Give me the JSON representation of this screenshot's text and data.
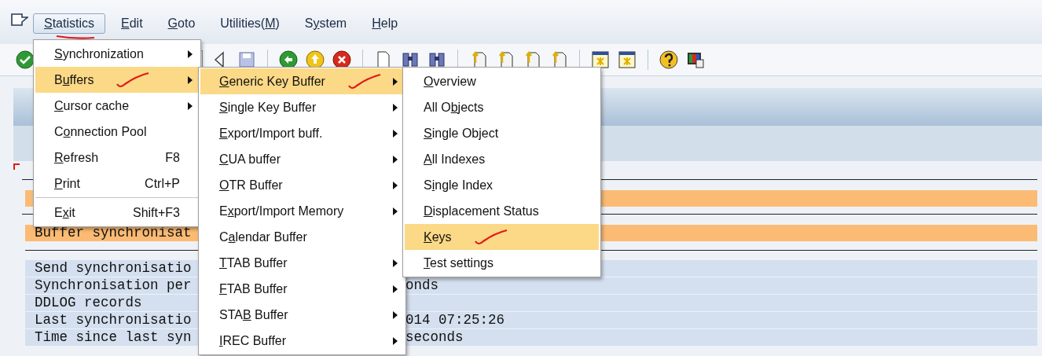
{
  "menu_bar": {
    "items": [
      {
        "key": "S",
        "post": "tatistics",
        "selected": true,
        "annotated": true
      },
      {
        "key": "E",
        "post": "dit",
        "selected": false,
        "annotated": false
      },
      {
        "key": "G",
        "post": "oto",
        "selected": false,
        "annotated": false
      },
      {
        "pre": "Utilities(",
        "key": "M",
        "post": ")",
        "selected": false,
        "annotated": false
      },
      {
        "pre": "S",
        "key": "y",
        "post": "stem",
        "selected": false,
        "annotated": false
      },
      {
        "key": "H",
        "post": "elp",
        "selected": false,
        "annotated": false
      }
    ]
  },
  "page": {
    "status_rows": [
      {},
      {
        "text": "Buffer synchronisat"
      }
    ],
    "info_rows": [
      {
        "label": "Send synchronisatio"
      },
      {
        "label": "Synchronisation per",
        "value": "onds"
      },
      {
        "label": "DDLOG records"
      },
      {
        "label": "Last synchronisatio",
        "value": "014 07:25:26"
      },
      {
        "label": "Time since last syn",
        "value": "seconds"
      }
    ]
  },
  "menus": [
    {
      "items": [
        {
          "key": "S",
          "post": "ynchronization",
          "submenu": true,
          "selected": false,
          "annotated": false
        },
        {
          "pre": "B",
          "key": "u",
          "post": "ffers",
          "submenu": true,
          "selected": true,
          "annotated": true
        },
        {
          "key": "C",
          "post": "ursor cache",
          "submenu": true,
          "selected": false,
          "annotated": false
        },
        {
          "pre": "C",
          "key": "o",
          "post": "nnection Pool",
          "submenu": false,
          "selected": false,
          "annotated": false
        },
        {
          "key": "R",
          "post": "efresh",
          "shortcut": "F8",
          "submenu": false,
          "selected": false,
          "annotated": false
        },
        {
          "key": "P",
          "post": "rint",
          "shortcut": "Ctrl+P",
          "submenu": false,
          "selected": false,
          "annotated": false
        },
        {
          "pre": "E",
          "key": "x",
          "post": "it",
          "shortcut": "Shift+F3",
          "separator_before": true,
          "submenu": false,
          "selected": false,
          "annotated": false
        }
      ]
    },
    {
      "items": [
        {
          "key": "G",
          "post": "eneric Key Buffer",
          "submenu": true,
          "selected": true,
          "annotated": true
        },
        {
          "key": "S",
          "post": "ingle Key Buffer",
          "submenu": true,
          "selected": false,
          "annotated": false
        },
        {
          "key": "E",
          "post": "xport/Import buff.",
          "submenu": true,
          "selected": false,
          "annotated": false
        },
        {
          "key": "C",
          "post": "UA buffer",
          "submenu": true,
          "selected": false,
          "annotated": false
        },
        {
          "key": "O",
          "post": "TR Buffer",
          "submenu": true,
          "selected": false,
          "annotated": false
        },
        {
          "pre": "E",
          "key": "x",
          "post": "port/Import Memory",
          "submenu": true,
          "selected": false,
          "annotated": false
        },
        {
          "pre": "C",
          "key": "a",
          "post": "lendar Buffer",
          "submenu": false,
          "selected": false,
          "annotated": false
        },
        {
          "key": "T",
          "post": "TAB Buffer",
          "submenu": true,
          "selected": false,
          "annotated": false
        },
        {
          "key": "F",
          "post": "TAB Buffer",
          "submenu": true,
          "selected": false,
          "annotated": false
        },
        {
          "pre": "STA",
          "key": "B",
          "post": " Buffer",
          "submenu": true,
          "selected": false,
          "annotated": false
        },
        {
          "key": "I",
          "post": "REC Buffer",
          "submenu": true,
          "selected": false,
          "annotated": false
        }
      ]
    },
    {
      "items": [
        {
          "key": "O",
          "post": "verview",
          "submenu": false,
          "selected": false,
          "annotated": false
        },
        {
          "pre": "All O",
          "key": "b",
          "post": "jects",
          "submenu": false,
          "selected": false,
          "annotated": false
        },
        {
          "key": "S",
          "post": "ingle Object",
          "submenu": false,
          "selected": false,
          "annotated": false
        },
        {
          "key": "A",
          "post": "ll Indexes",
          "submenu": false,
          "selected": false,
          "annotated": false
        },
        {
          "pre": "S",
          "key": "i",
          "post": "ngle Index",
          "submenu": false,
          "selected": false,
          "annotated": false
        },
        {
          "key": "D",
          "post": "isplacement Status",
          "submenu": false,
          "selected": false,
          "annotated": false
        },
        {
          "key": "K",
          "post": "eys",
          "submenu": false,
          "selected": true,
          "annotated": true
        },
        {
          "key": "T",
          "post": "est settings",
          "submenu": false,
          "selected": false,
          "annotated": false
        }
      ]
    }
  ]
}
